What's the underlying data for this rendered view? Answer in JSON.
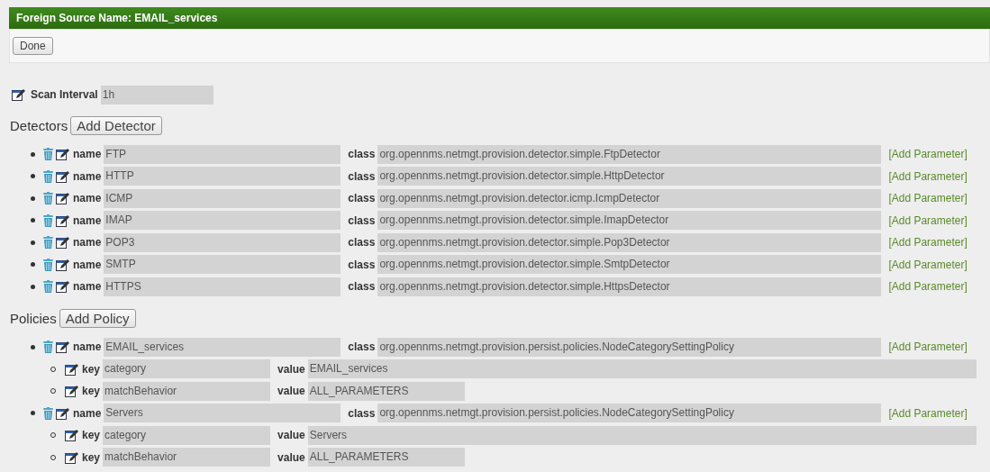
{
  "header": {
    "title": "Foreign Source Name: EMAIL_services"
  },
  "done_button": "Done",
  "scan_interval": {
    "label": "Scan Interval",
    "value": "1h"
  },
  "detectors": {
    "heading": "Detectors",
    "add_button": "Add Detector",
    "items": [
      {
        "name_label": "name",
        "name": "FTP",
        "class_label": "class",
        "class": "org.opennms.netmgt.provision.detector.simple.FtpDetector",
        "link": "[Add Parameter]"
      },
      {
        "name_label": "name",
        "name": "HTTP",
        "class_label": "class",
        "class": "org.opennms.netmgt.provision.detector.simple.HttpDetector",
        "link": "[Add Parameter]"
      },
      {
        "name_label": "name",
        "name": "ICMP",
        "class_label": "class",
        "class": "org.opennms.netmgt.provision.detector.icmp.IcmpDetector",
        "link": "[Add Parameter]"
      },
      {
        "name_label": "name",
        "name": "IMAP",
        "class_label": "class",
        "class": "org.opennms.netmgt.provision.detector.simple.ImapDetector",
        "link": "[Add Parameter]"
      },
      {
        "name_label": "name",
        "name": "POP3",
        "class_label": "class",
        "class": "org.opennms.netmgt.provision.detector.simple.Pop3Detector",
        "link": "[Add Parameter]"
      },
      {
        "name_label": "name",
        "name": "SMTP",
        "class_label": "class",
        "class": "org.opennms.netmgt.provision.detector.simple.SmtpDetector",
        "link": "[Add Parameter]"
      },
      {
        "name_label": "name",
        "name": "HTTPS",
        "class_label": "class",
        "class": "org.opennms.netmgt.provision.detector.simple.HttpsDetector",
        "link": "[Add Parameter]"
      }
    ]
  },
  "policies": {
    "heading": "Policies",
    "add_button": "Add Policy",
    "items": [
      {
        "name_label": "name",
        "name": "EMAIL_services",
        "class_label": "class",
        "class": "org.opennms.netmgt.provision.persist.policies.NodeCategorySettingPolicy",
        "link": "[Add Parameter]",
        "parameters": [
          {
            "key_label": "key",
            "key": "category",
            "value_label": "value",
            "value": "EMAIL_services"
          },
          {
            "key_label": "key",
            "key": "matchBehavior",
            "value_label": "value",
            "value": "ALL_PARAMETERS"
          }
        ]
      },
      {
        "name_label": "name",
        "name": "Servers",
        "class_label": "class",
        "class": "org.opennms.netmgt.provision.persist.policies.NodeCategorySettingPolicy",
        "link": "[Add Parameter]",
        "parameters": [
          {
            "key_label": "key",
            "key": "category",
            "value_label": "value",
            "value": "Servers"
          },
          {
            "key_label": "key",
            "key": "matchBehavior",
            "value_label": "value",
            "value": "ALL_PARAMETERS"
          }
        ]
      }
    ]
  }
}
